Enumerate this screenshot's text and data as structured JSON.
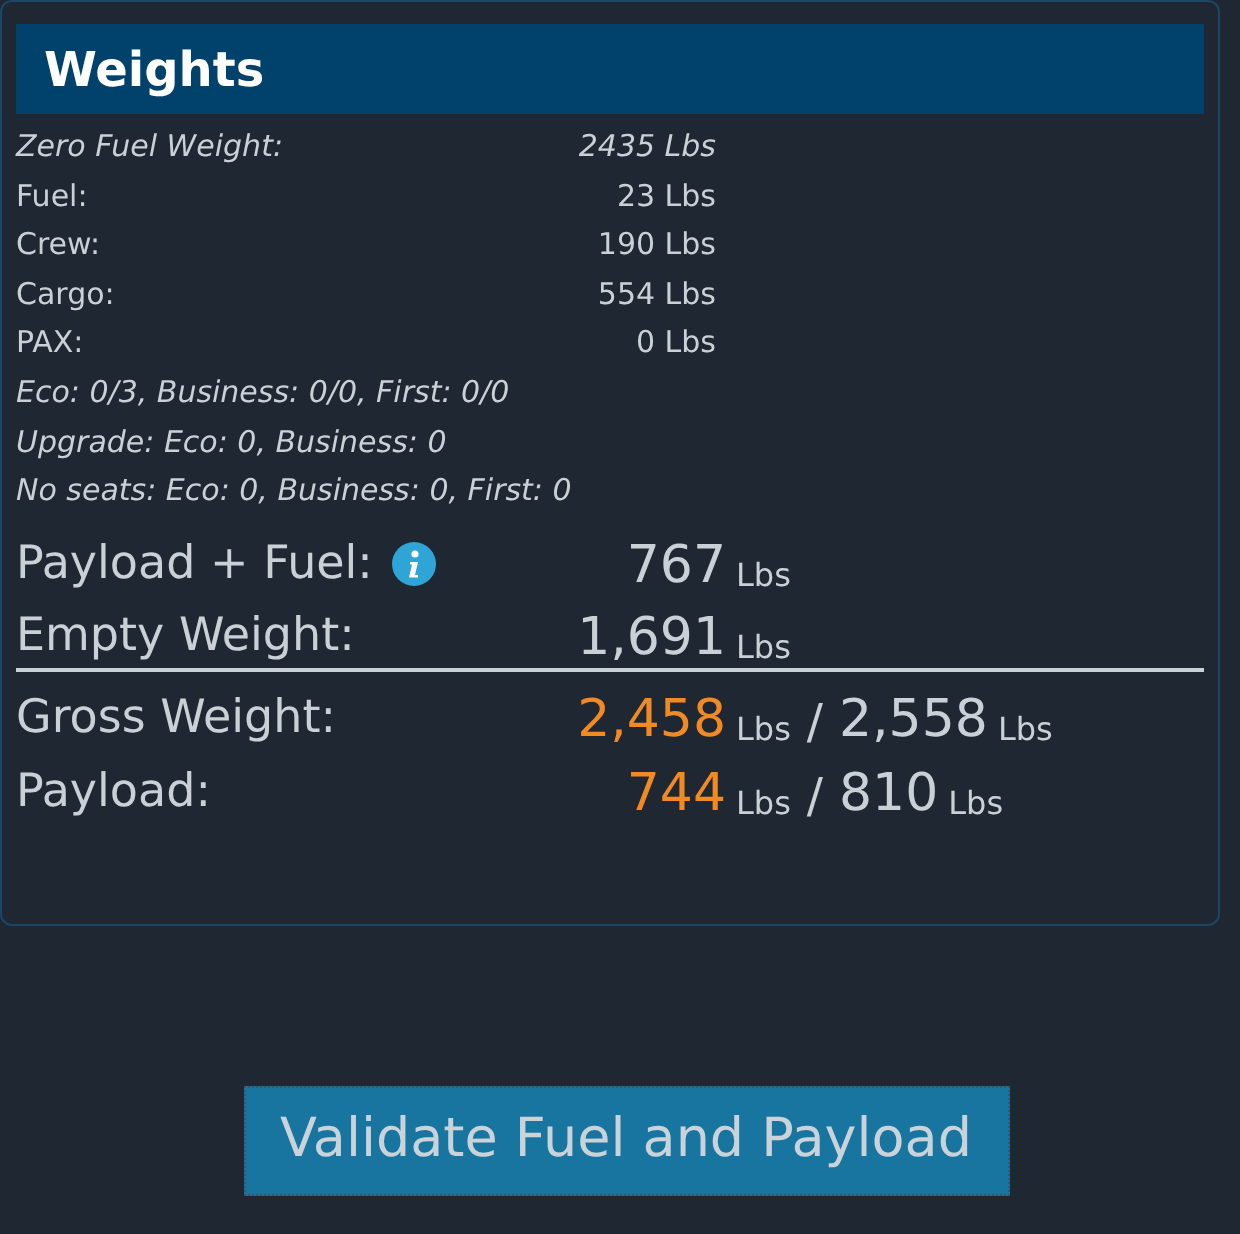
{
  "panel": {
    "title": "Weights"
  },
  "details": [
    {
      "label": "Zero Fuel Weight:",
      "value": "2435 Lbs",
      "kind": "italic"
    },
    {
      "label": "Fuel:",
      "value": "23 Lbs",
      "kind": "plain"
    },
    {
      "label": "Crew:",
      "value": "190 Lbs",
      "kind": "plain"
    },
    {
      "label": "Cargo:",
      "value": "554 Lbs",
      "kind": "plain"
    },
    {
      "label": "PAX:",
      "value": "0 Lbs",
      "kind": "plain"
    }
  ],
  "notes": [
    "Eco: 0/3, Business: 0/0, First: 0/0",
    "Upgrade: Eco: 0, Business: 0",
    "No seats: Eco: 0, Business: 0, First: 0"
  ],
  "totals": [
    {
      "label": "Payload + Fuel:",
      "value": "767",
      "unit": "Lbs",
      "info": true
    },
    {
      "label": "Empty Weight:",
      "value": "1,691",
      "unit": "Lbs",
      "info": false
    }
  ],
  "limits": [
    {
      "label": "Gross Weight:",
      "value": "2,458",
      "unit": "Lbs",
      "separator": "/",
      "max": "2,558",
      "max_unit": "Lbs"
    },
    {
      "label": "Payload:",
      "value": "744",
      "unit": "Lbs",
      "separator": "/",
      "max": "810",
      "max_unit": "Lbs"
    }
  ],
  "button": {
    "label": "Validate Fuel and Payload"
  }
}
